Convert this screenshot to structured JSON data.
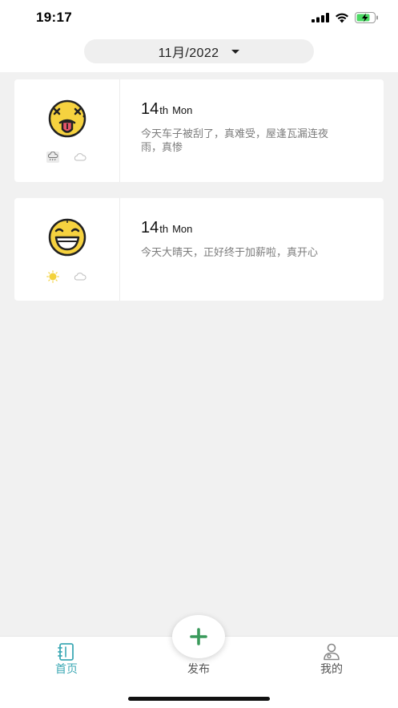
{
  "status_bar": {
    "time": "19:17"
  },
  "header": {
    "month": "11月/2022"
  },
  "entries": [
    {
      "mood_icon": "dizzy-tongue-emoji-icon",
      "weather_icons": [
        "rain-cloud-icon",
        "cloud-icon"
      ],
      "day": "14",
      "suffix": "th",
      "weekday": "Mon",
      "text": "今天车子被刮了，真难受，屋逢瓦漏连夜雨，真惨"
    },
    {
      "mood_icon": "grinning-emoji-icon",
      "weather_icons": [
        "sun-icon",
        "cloud-icon"
      ],
      "day": "14",
      "suffix": "th",
      "weekday": "Mon",
      "text": "今天大晴天，正好终于加薪啦，真开心"
    }
  ],
  "tab_bar": {
    "home_label": "首页",
    "publish_label": "发布",
    "mine_label": "我的"
  },
  "colors": {
    "accent": "#3ea9b5",
    "fab_plus": "#3a9a5b",
    "background": "#f1f1f1"
  }
}
